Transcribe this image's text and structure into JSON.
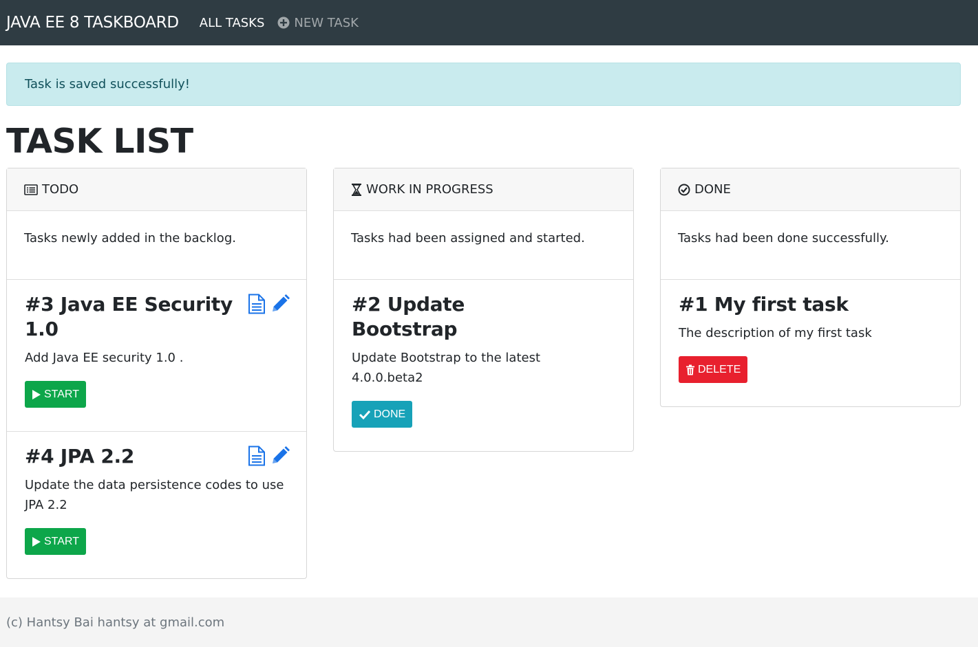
{
  "navbar": {
    "brand": "JAVA EE 8 TASKBOARD",
    "all_tasks": "ALL TASKS",
    "new_task": "NEW TASK",
    "bg_color": "#2f3c43"
  },
  "alert": {
    "message": "Task is saved successfully!",
    "color": "#c9ebee"
  },
  "page_title": "TASK LIST",
  "columns": {
    "todo": {
      "icon": "list-alt-icon",
      "title": "TODO",
      "description": "Tasks newly added in the backlog.",
      "tasks": [
        {
          "title": "#3 Java EE Security 1.0",
          "description": "Add Java EE security 1.0 .",
          "action": "START",
          "action_icon": "play-icon"
        },
        {
          "title": "#4 JPA 2.2",
          "description": "Update the data persistence codes to use JPA 2.2",
          "action": "START",
          "action_icon": "play-icon"
        }
      ]
    },
    "wip": {
      "icon": "hourglass-icon",
      "title": "WORK IN PROGRESS",
      "description": "Tasks had been assigned and started.",
      "tasks": [
        {
          "title": "#2 Update Bootstrap",
          "description": "Update Bootstrap to the latest 4.0.0.beta2",
          "action": "DONE",
          "action_icon": "check-icon"
        }
      ]
    },
    "done": {
      "icon": "check-circle-icon",
      "title": "DONE",
      "description": "Tasks had been done successfully.",
      "tasks": [
        {
          "title": "#1 My first task",
          "description": "The description of my first task",
          "action": "DELETE",
          "action_icon": "trash-icon"
        }
      ]
    }
  },
  "colors": {
    "start": "#0da64a",
    "done": "#17a2b8",
    "delete": "#e8202e",
    "link_blue": "#1a73e8"
  },
  "footer": {
    "text": "(c) Hantsy Bai hantsy at gmail.com"
  }
}
